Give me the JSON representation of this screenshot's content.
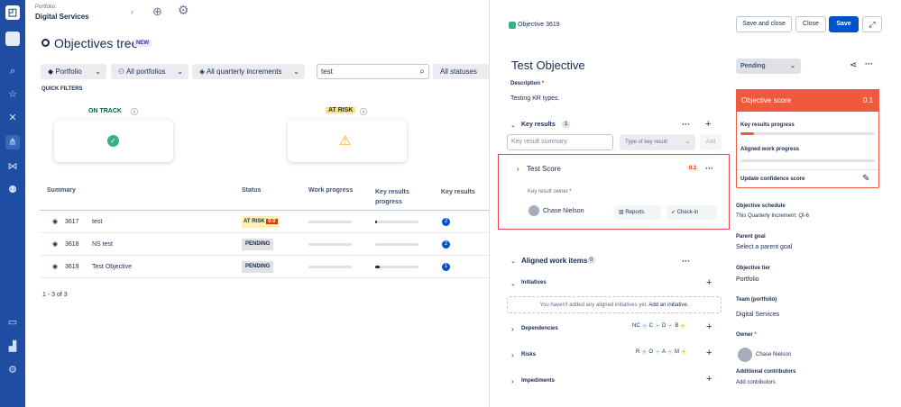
{
  "nav": {
    "icons": [
      "logo-icon",
      "home-icon",
      "search-icon",
      "star-icon",
      "shuffle-icon",
      "hierarchy-icon",
      "sitemap-icon",
      "team-icon",
      "monitor-icon",
      "chart-icon",
      "settings-icon"
    ]
  },
  "header": {
    "breadcrumb_small": "Portfolio:",
    "breadcrumb": "Digital Services"
  },
  "page": {
    "title": "Objectives tree",
    "new_badge": "NEW"
  },
  "filters": {
    "portfolio": "Portfolio",
    "all_portfolios": "All portfolios",
    "increments": "All quarterly increments",
    "search_value": "test",
    "statuses": "All statuses"
  },
  "quick_filters": {
    "label": "QUICK FILTERS",
    "on_track": "ON TRACK",
    "at_risk": "AT RISK"
  },
  "table": {
    "headers": {
      "summary": "Summary",
      "status": "Status",
      "work_progress": "Work progress",
      "kr_progress": "Key results progress",
      "key_results": "Key results"
    },
    "rows": [
      {
        "id": "3617",
        "name": "test",
        "status": "AT RISK",
        "score": "0.0",
        "kr_count": "2",
        "kr_progress": 0.04
      },
      {
        "id": "3618",
        "name": "NS test",
        "status": "PENDING",
        "score": "",
        "kr_count": "2",
        "kr_progress": 0.0
      },
      {
        "id": "3619",
        "name": "Test Objective",
        "status": "PENDING",
        "score": "",
        "kr_count": "1",
        "kr_progress": 0.1
      }
    ],
    "pagination": "1 - 3 of 3"
  },
  "panel": {
    "objective_id": "Objective 3619",
    "save_close": "Save and close",
    "close": "Close",
    "save": "Save",
    "title": "Test Objective",
    "description_label": "Description",
    "description": "Testing KR types.",
    "key_results_label": "Key results",
    "key_results_count": "1",
    "kr_summary_placeholder": "Key result summary",
    "kr_type_placeholder": "Type of key result",
    "add": "Add",
    "kr_item": {
      "name": "Test Score",
      "score": "0.1",
      "owner_label": "Key result owner",
      "owner": "Chase Nielson",
      "reports": "Reports",
      "checkin": "Check-in"
    },
    "aligned_label": "Aligned work items",
    "aligned_count": "0",
    "initiatives_label": "Initiatives",
    "initiatives_empty": "You haven't added any aligned initiatives yet.",
    "add_initiative": "Add an initiative.",
    "dependencies_label": "Dependencies",
    "dependencies_tags": [
      "NC",
      "-",
      "C",
      "-",
      "D",
      "-",
      "B",
      "-"
    ],
    "risks_label": "Risks",
    "risks_tags": [
      "R",
      "-",
      "O",
      "-",
      "A",
      "-",
      "M",
      "-"
    ],
    "impediments_label": "Impediments",
    "status_select": "Pending",
    "score_label": "Objective score",
    "score_value": "0.1",
    "kr_progress_label": "Key results progress",
    "aligned_progress_label": "Aligned work progress",
    "update_confidence": "Update confidence score",
    "schedule_label": "Objective schedule",
    "schedule_value": "This Quarterly Increment:  QI-6",
    "parent_label": "Parent goal",
    "parent_value": "Select a parent goal",
    "tier_label": "Objective tier",
    "tier_value": "Portfolio",
    "team_label": "Team (portfolio)",
    "team_value": "Digital Services",
    "owner_label": "Owner",
    "owner_value": "Chase Nielson",
    "contrib_label": "Additional contributors",
    "contrib_value": "Add contributors"
  },
  "colors": {
    "nav": "#1f4da1",
    "accent": "#0052cc",
    "score": "#f05a3c",
    "highlight": "#e5484d"
  }
}
